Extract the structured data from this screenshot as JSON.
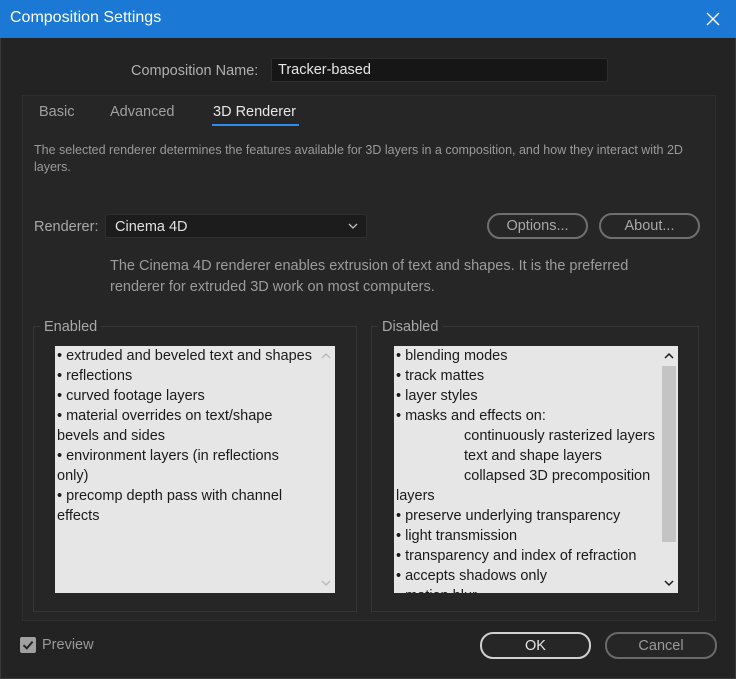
{
  "window": {
    "title": "Composition Settings"
  },
  "composition": {
    "name_label": "Composition Name:",
    "name_value": "Tracker-based"
  },
  "tabs": [
    {
      "label": "Basic",
      "active": false
    },
    {
      "label": "Advanced",
      "active": false
    },
    {
      "label": "3D Renderer",
      "active": true
    }
  ],
  "description": "The selected renderer determines the features available for 3D layers in a composition, and how they interact with 2D layers.",
  "renderer": {
    "label": "Renderer:",
    "selected": "Cinema 4D",
    "options_label": "Options...",
    "about_label": "About...",
    "info": "The Cinema 4D renderer enables extrusion of text and shapes. It is the preferred renderer for extruded 3D work on most computers."
  },
  "enabled": {
    "title": "Enabled",
    "items": [
      "• extruded and beveled text and shapes",
      "• reflections",
      "• curved footage layers",
      "• material overrides on text/shape bevels and sides",
      "• environment layers (in reflections only)",
      "• precomp depth pass with channel effects"
    ]
  },
  "disabled": {
    "title": "Disabled",
    "lines": [
      {
        "text": "• blending modes",
        "indent": false
      },
      {
        "text": "• track mattes",
        "indent": false
      },
      {
        "text": "• layer styles",
        "indent": false
      },
      {
        "text": "• masks and effects on:",
        "indent": false
      },
      {
        "text": "continuously rasterized layers",
        "indent": true
      },
      {
        "text": "text and shape layers",
        "indent": true
      },
      {
        "text": "collapsed 3D precomposition",
        "indent": true
      },
      {
        "text": "layers",
        "indent": false
      },
      {
        "text": "• preserve underlying transparency",
        "indent": false
      },
      {
        "text": "• light transmission",
        "indent": false
      },
      {
        "text": "• transparency and index of refraction",
        "indent": false
      },
      {
        "text": "• accepts shadows only",
        "indent": false
      },
      {
        "text": "• motion blur",
        "indent": false
      }
    ]
  },
  "footer": {
    "preview_label": "Preview",
    "preview_checked": true,
    "ok_label": "OK",
    "cancel_label": "Cancel"
  },
  "colors": {
    "titlebar": "#1b78d4",
    "accent": "#2d8ceb",
    "background": "#232323",
    "listbox": "#e6e6e6"
  }
}
